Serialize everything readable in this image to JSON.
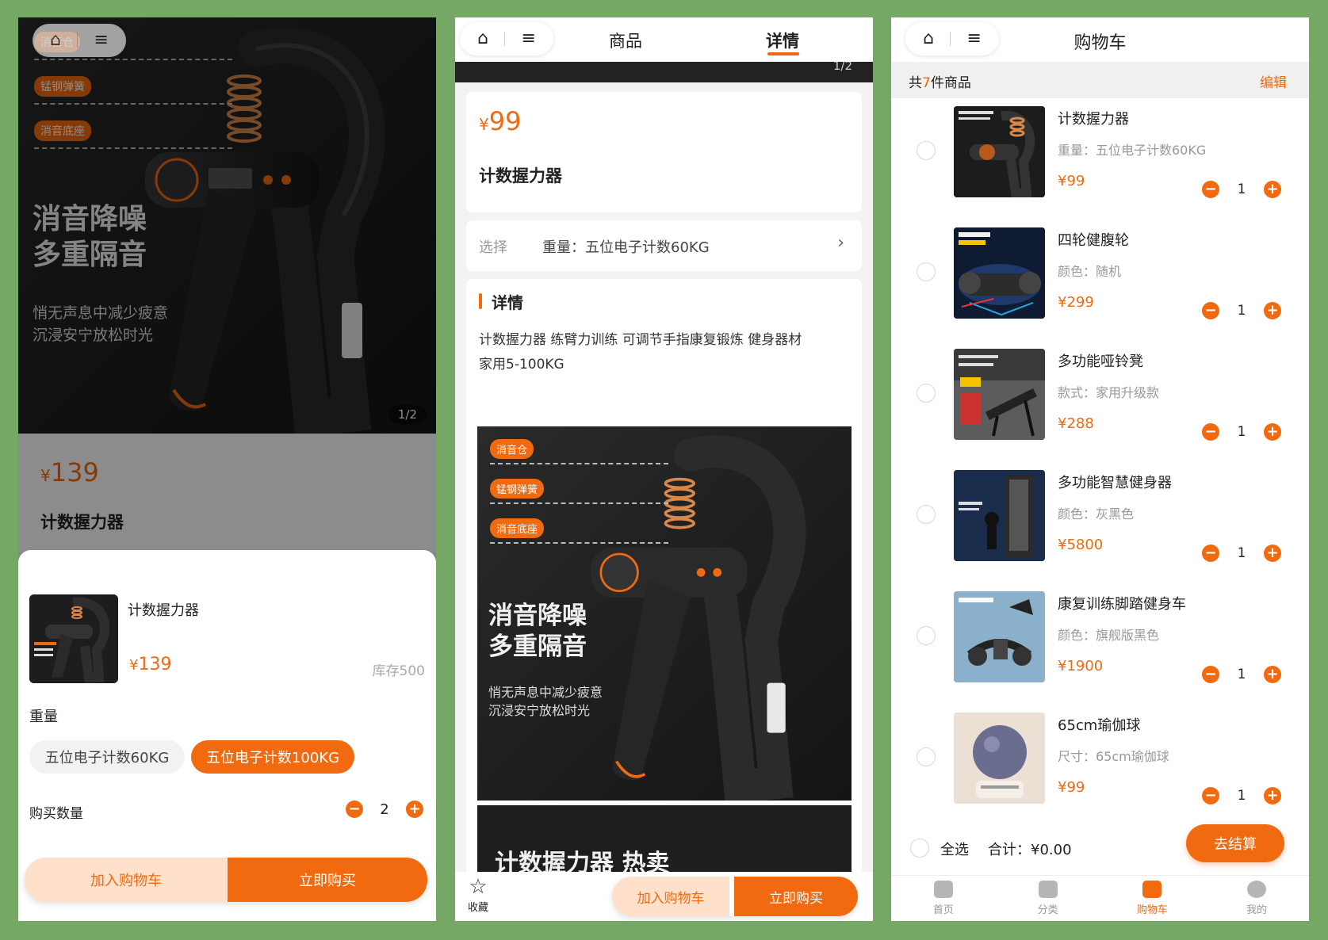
{
  "colors": {
    "accent": "#f26a10",
    "accent_light": "#ffe1cb",
    "page_bg": "#74a864"
  },
  "art": {
    "tags": [
      "消音仓",
      "锰钢弹簧",
      "消音底座"
    ],
    "title_line1": "消音降噪",
    "title_line2": "多重隔音",
    "sub_line1": "悄无声息中减少疲意",
    "sub_line2": "沉浸安宁放松时光"
  },
  "screen1": {
    "image_counter": "1/2",
    "price_symbol": "¥",
    "price": "139",
    "product_name": "计数握力器",
    "sheet": {
      "name": "计数握力器",
      "price_symbol": "¥",
      "price": "139",
      "stock": "库存500",
      "spec_label": "重量",
      "options": [
        {
          "label": "五位电子计数60KG",
          "selected": false
        },
        {
          "label": "五位电子计数100KG",
          "selected": true
        }
      ],
      "qty_label": "购买数量",
      "qty": "2",
      "add_cart": "加入购物车",
      "buy_now": "立即购买"
    }
  },
  "screen2": {
    "tabs": [
      "商品",
      "详情"
    ],
    "active_tab": "详情",
    "image_counter": "1/2",
    "price_symbol": "¥",
    "price": "99",
    "product_name": "计数握力器",
    "select_label": "选择",
    "select_value": "重量：五位电子计数60KG",
    "detail_title": "详情",
    "detail_text_line1": "计数握力器 练臂力训练 可调节手指康复锻炼 健身器材",
    "detail_text_line2": "家用5-100KG",
    "banner_text": "计数握力器 热卖",
    "favorite_label": "收藏",
    "add_cart": "加入购物车",
    "buy_now": "立即购买"
  },
  "screen3": {
    "title": "购物车",
    "count_prefix": "共",
    "count": "7",
    "count_suffix": "件商品",
    "edit": "编辑",
    "items": [
      {
        "name": "计数握力器",
        "spec": "重量：五位电子计数60KG",
        "price": "¥99",
        "qty": "1"
      },
      {
        "name": "四轮健腹轮",
        "spec": "颜色：随机",
        "price": "¥299",
        "qty": "1"
      },
      {
        "name": "多功能哑铃凳",
        "spec": "款式：家用升级款",
        "price": "¥288",
        "qty": "1"
      },
      {
        "name": "多功能智慧健身器",
        "spec": "颜色：灰黑色",
        "price": "¥5800",
        "qty": "1"
      },
      {
        "name": "康复训练脚踏健身车",
        "spec": "颜色：旗舰版黑色",
        "price": "¥1900",
        "qty": "1"
      },
      {
        "name": "65cm瑜伽球",
        "spec": "尺寸：65cm瑜伽球",
        "price": "¥99",
        "qty": "1"
      }
    ],
    "select_all": "全选",
    "total_label": "合计：",
    "total": "¥0.00",
    "checkout": "去结算",
    "tabbar": [
      {
        "label": "首页",
        "icon": "home-icon",
        "active": false
      },
      {
        "label": "分类",
        "icon": "grid-icon",
        "active": false
      },
      {
        "label": "购物车",
        "icon": "cart-icon",
        "active": true
      },
      {
        "label": "我的",
        "icon": "user-icon",
        "active": false
      }
    ]
  }
}
